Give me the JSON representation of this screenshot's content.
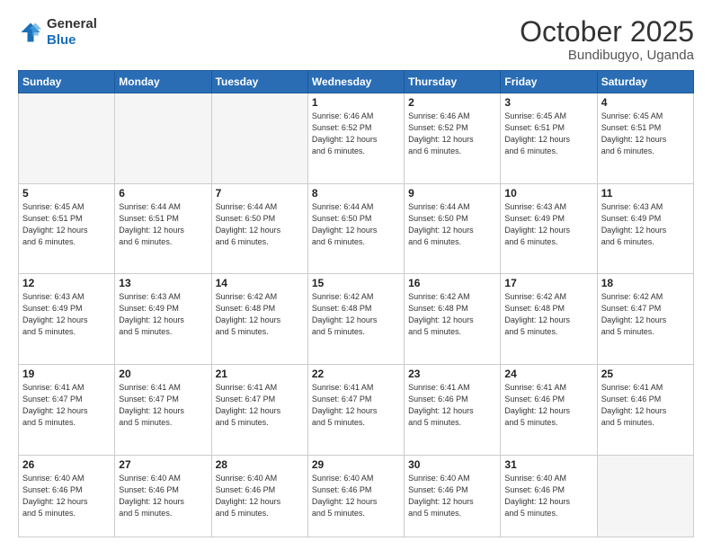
{
  "header": {
    "logo_general": "General",
    "logo_blue": "Blue",
    "month": "October 2025",
    "location": "Bundibugyo, Uganda"
  },
  "weekdays": [
    "Sunday",
    "Monday",
    "Tuesday",
    "Wednesday",
    "Thursday",
    "Friday",
    "Saturday"
  ],
  "weeks": [
    [
      {
        "day": "",
        "info": ""
      },
      {
        "day": "",
        "info": ""
      },
      {
        "day": "",
        "info": ""
      },
      {
        "day": "1",
        "info": "Sunrise: 6:46 AM\nSunset: 6:52 PM\nDaylight: 12 hours\nand 6 minutes."
      },
      {
        "day": "2",
        "info": "Sunrise: 6:46 AM\nSunset: 6:52 PM\nDaylight: 12 hours\nand 6 minutes."
      },
      {
        "day": "3",
        "info": "Sunrise: 6:45 AM\nSunset: 6:51 PM\nDaylight: 12 hours\nand 6 minutes."
      },
      {
        "day": "4",
        "info": "Sunrise: 6:45 AM\nSunset: 6:51 PM\nDaylight: 12 hours\nand 6 minutes."
      }
    ],
    [
      {
        "day": "5",
        "info": "Sunrise: 6:45 AM\nSunset: 6:51 PM\nDaylight: 12 hours\nand 6 minutes."
      },
      {
        "day": "6",
        "info": "Sunrise: 6:44 AM\nSunset: 6:51 PM\nDaylight: 12 hours\nand 6 minutes."
      },
      {
        "day": "7",
        "info": "Sunrise: 6:44 AM\nSunset: 6:50 PM\nDaylight: 12 hours\nand 6 minutes."
      },
      {
        "day": "8",
        "info": "Sunrise: 6:44 AM\nSunset: 6:50 PM\nDaylight: 12 hours\nand 6 minutes."
      },
      {
        "day": "9",
        "info": "Sunrise: 6:44 AM\nSunset: 6:50 PM\nDaylight: 12 hours\nand 6 minutes."
      },
      {
        "day": "10",
        "info": "Sunrise: 6:43 AM\nSunset: 6:49 PM\nDaylight: 12 hours\nand 6 minutes."
      },
      {
        "day": "11",
        "info": "Sunrise: 6:43 AM\nSunset: 6:49 PM\nDaylight: 12 hours\nand 6 minutes."
      }
    ],
    [
      {
        "day": "12",
        "info": "Sunrise: 6:43 AM\nSunset: 6:49 PM\nDaylight: 12 hours\nand 5 minutes."
      },
      {
        "day": "13",
        "info": "Sunrise: 6:43 AM\nSunset: 6:49 PM\nDaylight: 12 hours\nand 5 minutes."
      },
      {
        "day": "14",
        "info": "Sunrise: 6:42 AM\nSunset: 6:48 PM\nDaylight: 12 hours\nand 5 minutes."
      },
      {
        "day": "15",
        "info": "Sunrise: 6:42 AM\nSunset: 6:48 PM\nDaylight: 12 hours\nand 5 minutes."
      },
      {
        "day": "16",
        "info": "Sunrise: 6:42 AM\nSunset: 6:48 PM\nDaylight: 12 hours\nand 5 minutes."
      },
      {
        "day": "17",
        "info": "Sunrise: 6:42 AM\nSunset: 6:48 PM\nDaylight: 12 hours\nand 5 minutes."
      },
      {
        "day": "18",
        "info": "Sunrise: 6:42 AM\nSunset: 6:47 PM\nDaylight: 12 hours\nand 5 minutes."
      }
    ],
    [
      {
        "day": "19",
        "info": "Sunrise: 6:41 AM\nSunset: 6:47 PM\nDaylight: 12 hours\nand 5 minutes."
      },
      {
        "day": "20",
        "info": "Sunrise: 6:41 AM\nSunset: 6:47 PM\nDaylight: 12 hours\nand 5 minutes."
      },
      {
        "day": "21",
        "info": "Sunrise: 6:41 AM\nSunset: 6:47 PM\nDaylight: 12 hours\nand 5 minutes."
      },
      {
        "day": "22",
        "info": "Sunrise: 6:41 AM\nSunset: 6:47 PM\nDaylight: 12 hours\nand 5 minutes."
      },
      {
        "day": "23",
        "info": "Sunrise: 6:41 AM\nSunset: 6:46 PM\nDaylight: 12 hours\nand 5 minutes."
      },
      {
        "day": "24",
        "info": "Sunrise: 6:41 AM\nSunset: 6:46 PM\nDaylight: 12 hours\nand 5 minutes."
      },
      {
        "day": "25",
        "info": "Sunrise: 6:41 AM\nSunset: 6:46 PM\nDaylight: 12 hours\nand 5 minutes."
      }
    ],
    [
      {
        "day": "26",
        "info": "Sunrise: 6:40 AM\nSunset: 6:46 PM\nDaylight: 12 hours\nand 5 minutes."
      },
      {
        "day": "27",
        "info": "Sunrise: 6:40 AM\nSunset: 6:46 PM\nDaylight: 12 hours\nand 5 minutes."
      },
      {
        "day": "28",
        "info": "Sunrise: 6:40 AM\nSunset: 6:46 PM\nDaylight: 12 hours\nand 5 minutes."
      },
      {
        "day": "29",
        "info": "Sunrise: 6:40 AM\nSunset: 6:46 PM\nDaylight: 12 hours\nand 5 minutes."
      },
      {
        "day": "30",
        "info": "Sunrise: 6:40 AM\nSunset: 6:46 PM\nDaylight: 12 hours\nand 5 minutes."
      },
      {
        "day": "31",
        "info": "Sunrise: 6:40 AM\nSunset: 6:46 PM\nDaylight: 12 hours\nand 5 minutes."
      },
      {
        "day": "",
        "info": ""
      }
    ]
  ]
}
